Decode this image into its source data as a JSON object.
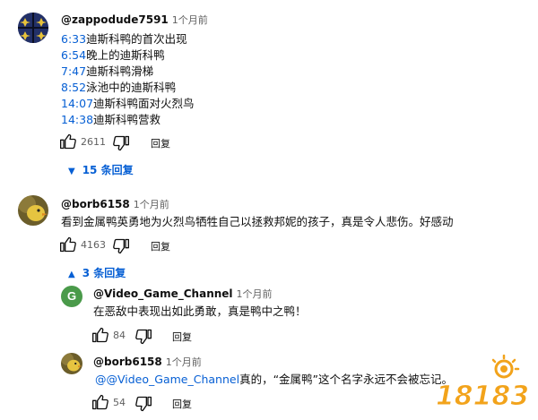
{
  "comments": [
    {
      "author": "@zappodude7591",
      "time": "1个月前",
      "lines": [
        {
          "ts": "6:33",
          "text": "迪斯科鸭的首次出现"
        },
        {
          "ts": "6:54",
          "text": "晚上的迪斯科鸭"
        },
        {
          "ts": "7:47",
          "text": "迪斯科鸭滑梯"
        },
        {
          "ts": "8:52",
          "text": "泳池中的迪斯科鸭"
        },
        {
          "ts": "14:07",
          "text": "迪斯科鸭面对火烈鸟"
        },
        {
          "ts": "14:38",
          "text": "迪斯科鸭营救"
        }
      ],
      "likes": "2611",
      "reply_label": "回复",
      "replies_toggle": "15 条回复"
    },
    {
      "author": "@borb6158",
      "time": "1个月前",
      "text": "看到金属鸭英勇地为火烈鸟牺牲自己以拯救邦妮的孩子，真是令人悲伤。好感动",
      "likes": "4163",
      "reply_label": "回复",
      "replies_toggle": "3 条回复"
    }
  ],
  "replies": [
    {
      "author": "@Video_Game_Channel",
      "time": "1个月前",
      "avatar_letter": "G",
      "text": "在恶敌中表现出如此勇敢，真是鸭中之鸭！",
      "likes": "84",
      "reply_label": "回复"
    },
    {
      "author": "@borb6158",
      "time": "1个月前",
      "mention": "@@Video_Game_Channel",
      "text": "真的，“金属鸭”这个名字永远不会被忘记。",
      "likes": "54",
      "reply_label": "回复"
    }
  ],
  "watermark": "18183",
  "colors": {
    "link": "#065fd4",
    "avatar_g": "#4a9a4a",
    "watermark": "#f2a31b"
  }
}
